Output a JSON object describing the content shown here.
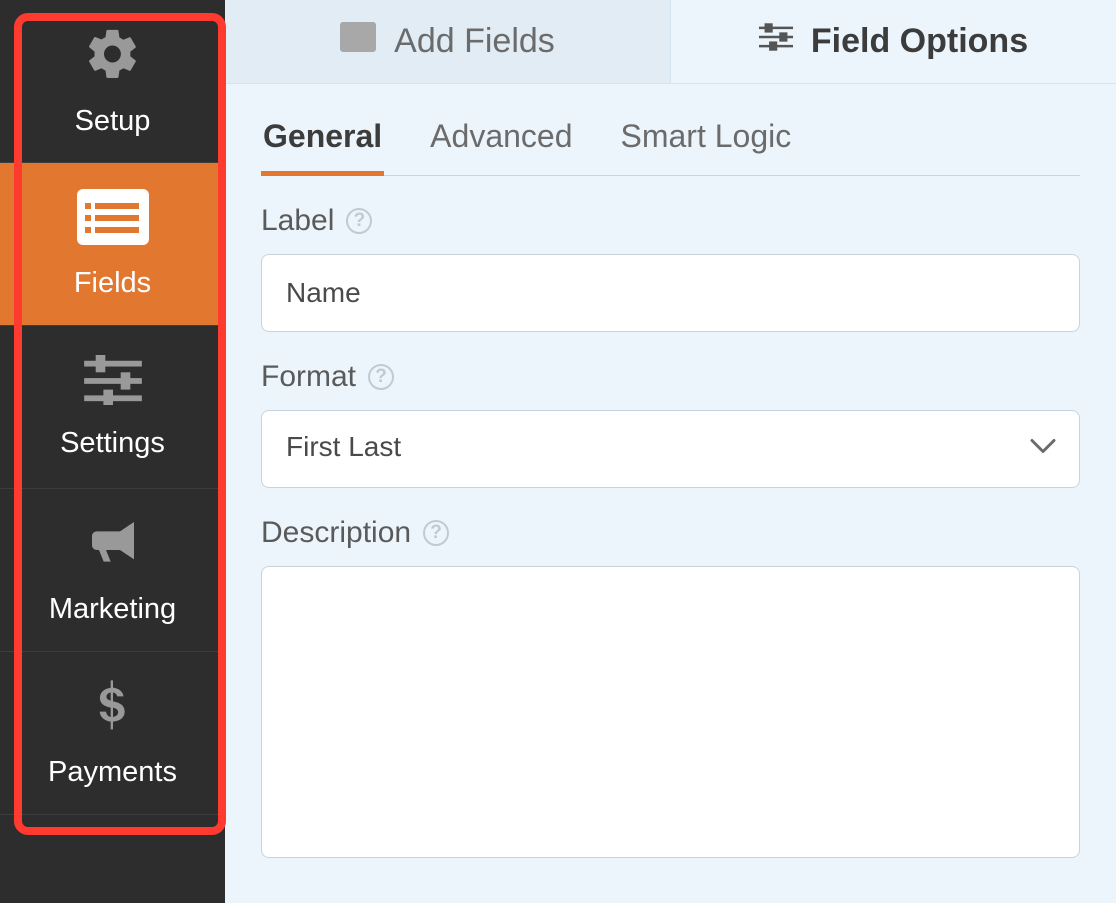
{
  "sidebar": {
    "items": [
      {
        "label": "Setup"
      },
      {
        "label": "Fields"
      },
      {
        "label": "Settings"
      },
      {
        "label": "Marketing"
      },
      {
        "label": "Payments"
      }
    ]
  },
  "toptabs": {
    "add_fields": "Add Fields",
    "field_options": "Field Options"
  },
  "subtabs": {
    "general": "General",
    "advanced": "Advanced",
    "smart_logic": "Smart Logic"
  },
  "fields": {
    "label_title": "Label",
    "label_value": "Name",
    "format_title": "Format",
    "format_value": "First Last",
    "description_title": "Description",
    "description_value": ""
  }
}
